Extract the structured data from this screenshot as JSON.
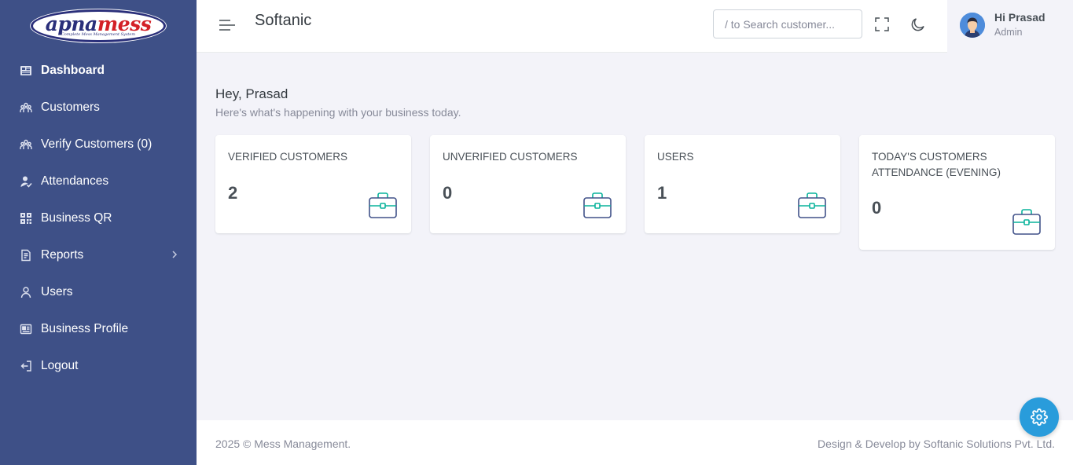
{
  "logo": {
    "primary": "apna",
    "secondary": "mess",
    "tagline": "Complete Mess Management System"
  },
  "sidebar": {
    "items": [
      {
        "label": "Dashboard",
        "icon": "dashboard-icon",
        "active": true
      },
      {
        "label": "Customers",
        "icon": "customers-icon"
      },
      {
        "label": "Verify Customers (0)",
        "icon": "verify-customers-icon"
      },
      {
        "label": "Attendances",
        "icon": "attendance-icon"
      },
      {
        "label": "Business QR",
        "icon": "qr-code-icon"
      },
      {
        "label": "Reports",
        "icon": "reports-icon",
        "has_submenu": true
      },
      {
        "label": "Users",
        "icon": "user-icon"
      },
      {
        "label": "Business Profile",
        "icon": "business-profile-icon"
      },
      {
        "label": "Logout",
        "icon": "logout-icon"
      }
    ]
  },
  "header": {
    "title": "Softanic",
    "search_placeholder": "/ to Search customer...",
    "user": {
      "name": "Hi Prasad",
      "role": "Admin"
    }
  },
  "main": {
    "greeting": "Hey, Prasad",
    "subtitle": "Here's what's happening with your business today.",
    "cards": [
      {
        "title": "VERIFIED CUSTOMERS",
        "value": "2"
      },
      {
        "title": "UNVERIFIED CUSTOMERS",
        "value": "0"
      },
      {
        "title": "USERS",
        "value": "1"
      },
      {
        "title": "TODAY'S CUSTOMERS ATTENDANCE (EVENING)",
        "value": "0"
      }
    ]
  },
  "footer": {
    "left": "2025 © Mess Management.",
    "right": "Design & Develop by Softanic Solutions Pvt. Ltd."
  },
  "colors": {
    "sidebar": "#3e5087",
    "accent": "#299cdb",
    "icon_teal": "#0ab39c",
    "icon_navy": "#405189"
  }
}
